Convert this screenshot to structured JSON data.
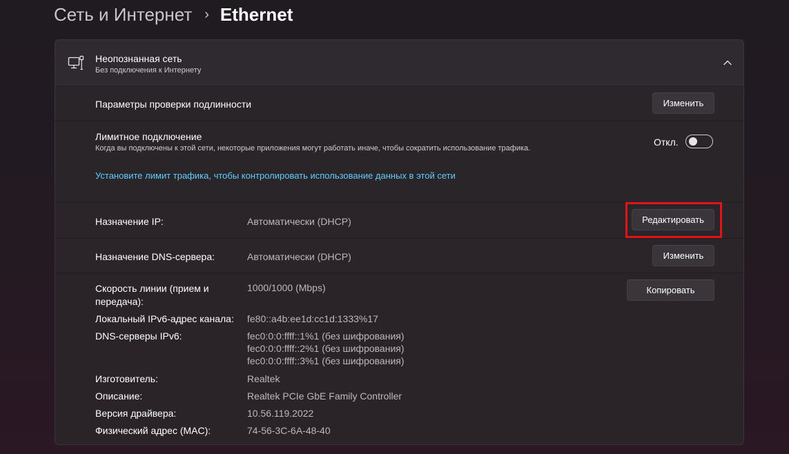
{
  "breadcrumb": {
    "parent": "Сеть и Интернет",
    "separator": "›",
    "current": "Ethernet"
  },
  "network": {
    "icon": "ethernet-monitor-icon",
    "name": "Неопознанная сеть",
    "status": "Без подключения к Интернету",
    "collapse_icon": "chevron-up-icon"
  },
  "auth": {
    "label": "Параметры проверки подлинности",
    "button": "Изменить"
  },
  "metered": {
    "label": "Лимитное подключение",
    "description": "Когда вы подключены к этой сети, некоторые приложения могут работать иначе, чтобы сократить использование трафика.",
    "toggle_state": "Откл.",
    "toggle_on": false,
    "link": "Установите лимит трафика, чтобы контролировать использование данных в этой сети"
  },
  "ip": {
    "label": "Назначение IP:",
    "value": "Автоматически (DHCP)",
    "button": "Редактировать"
  },
  "dns": {
    "label": "Назначение DNS-сервера:",
    "value": "Автоматически (DHCP)",
    "button": "Изменить"
  },
  "properties": {
    "copy_button": "Копировать",
    "speed_label": "Скорость линии (прием и передача):",
    "speed_value": "1000/1000 (Mbps)",
    "ipv6_label": "Локальный IPv6-адрес канала:",
    "ipv6_value": "fe80::a4b:ee1d:cc1d:1333%17",
    "dns_ipv6_label": "DNS-серверы IPv6:",
    "dns_ipv6_values": [
      "fec0:0:0:ffff::1%1 (без шифрования)",
      "fec0:0:0:ffff::2%1 (без шифрования)",
      "fec0:0:0:ffff::3%1 (без шифрования)"
    ],
    "manufacturer_label": "Изготовитель:",
    "manufacturer_value": "Realtek",
    "description_label": "Описание:",
    "description_value": "Realtek PCIe GbE Family Controller",
    "driver_label": "Версия драйвера:",
    "driver_value": "10.56.119.2022",
    "mac_label": "Физический адрес (MAC):",
    "mac_value": "74-56-3C-6A-48-40"
  },
  "colors": {
    "accent_link": "#60cdff",
    "highlight_box": "#e1141a"
  }
}
